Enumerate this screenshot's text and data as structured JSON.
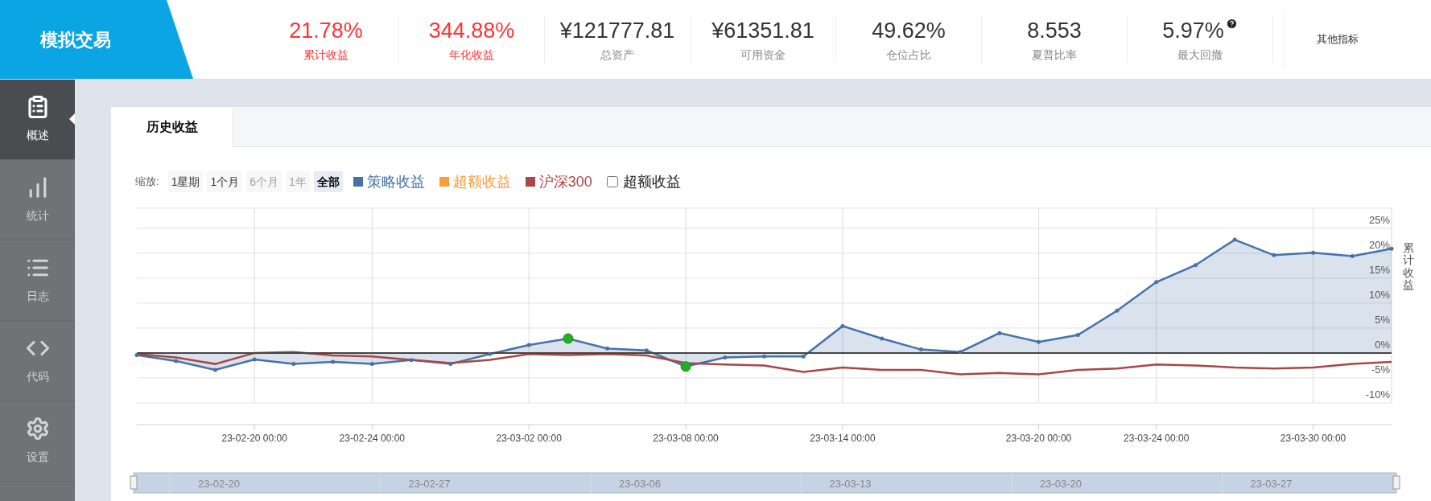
{
  "header": {
    "title": "模拟交易",
    "stats": [
      {
        "value": "21.78%",
        "label": "累计收益",
        "color": "#ff3333",
        "help": false
      },
      {
        "value": "344.88%",
        "label": "年化收益",
        "color": "#ff3333",
        "help": false
      },
      {
        "value": "¥121777.81",
        "label": "总资产",
        "color": "#333333",
        "help": false
      },
      {
        "value": "¥61351.81",
        "label": "可用资金",
        "color": "#333333",
        "help": false
      },
      {
        "value": "49.62%",
        "label": "仓位占比",
        "color": "#333333",
        "help": false
      },
      {
        "value": "8.553",
        "label": "夏普比率",
        "color": "#333333",
        "help": false
      },
      {
        "value": "5.97%",
        "label": "最大回撤",
        "color": "#333333",
        "help": true
      }
    ],
    "more": "其他指标"
  },
  "sidebar": {
    "items": [
      {
        "label": "概述",
        "selected": true
      },
      {
        "label": "统计",
        "selected": false
      },
      {
        "label": "日志",
        "selected": false
      },
      {
        "label": "代码",
        "selected": false
      },
      {
        "label": "设置",
        "selected": false
      }
    ]
  },
  "tabs": [
    {
      "label": "历史收益",
      "selected": true
    }
  ],
  "zoom": {
    "label": "缩放:",
    "buttons": [
      {
        "label": "1星期",
        "selected": false,
        "disabled": false
      },
      {
        "label": "1个月",
        "selected": false,
        "disabled": false
      },
      {
        "label": "6个月",
        "selected": false,
        "disabled": true
      },
      {
        "label": "1年",
        "selected": false,
        "disabled": true
      },
      {
        "label": "全部",
        "selected": true,
        "disabled": false
      }
    ]
  },
  "legend": [
    {
      "kind": "series"
    },
    {
      "label": "超额收益",
      "color": "#f79d3d",
      "kind": "swatch"
    },
    {
      "kind": "series"
    },
    {
      "label": "超额收益",
      "kind": "checkbox",
      "checked": false
    }
  ],
  "chart_data": {
    "type": "line",
    "ylabel": "累计收益",
    "categories": [
      null,
      null,
      null,
      "23-02-20 00:00",
      null,
      null,
      "23-02-24 00:00",
      null,
      null,
      null,
      "23-03-02 00:00",
      null,
      null,
      null,
      "23-03-08 00:00",
      null,
      null,
      null,
      "23-03-14 00:00",
      null,
      null,
      null,
      null,
      "23-03-20 00:00",
      null,
      null,
      "23-03-24 00:00",
      null,
      null,
      null,
      "23-03-30 00:00",
      null,
      null
    ],
    "series": [
      {
        "name": "策略收益",
        "color": "#4572a7",
        "values": [
          -0.4,
          -1.6,
          -3.4,
          -1.3,
          -2.2,
          -1.8,
          -2.2,
          -1.4,
          -2.2,
          -0.2,
          1.6,
          2.9,
          0.9,
          0.5,
          -2.7,
          -0.9,
          -0.7,
          -0.7,
          5.4,
          2.9,
          0.7,
          0.2,
          4.0,
          2.2,
          3.6,
          8.5,
          14.2,
          17.6,
          22.7,
          19.6,
          20.1,
          19.4,
          20.9
        ]
      },
      {
        "name": "沪深300",
        "color": "#aa4643",
        "values": [
          -0.2,
          -0.9,
          -2.2,
          0,
          0.2,
          -0.5,
          -0.7,
          -1.4,
          -2.0,
          -1.4,
          -0.2,
          -0.4,
          -0.2,
          -0.5,
          -2.0,
          -2.3,
          -2.5,
          -3.8,
          -2.9,
          -3.4,
          -3.4,
          -4.3,
          -4.0,
          -4.3,
          -3.4,
          -3.1,
          -2.3,
          -2.5,
          -2.9,
          -3.1,
          -2.9,
          -2.2,
          -1.8
        ]
      }
    ],
    "ylim": [
      -10,
      29
    ],
    "grid": true,
    "yticks": [
      {
        "value": -10,
        "label": "-10%"
      },
      {
        "value": -5,
        "label": "-5%"
      },
      {
        "value": 0,
        "label": "0%"
      },
      {
        "value": 5,
        "label": "5%"
      },
      {
        "value": 10,
        "label": "10%"
      },
      {
        "value": 15,
        "label": "15%"
      },
      {
        "value": 20,
        "label": "20%"
      },
      {
        "value": 25,
        "label": "25%"
      }
    ]
  },
  "flag_markers": {
    "flagged": [
      false,
      false,
      false,
      false,
      false,
      false,
      false,
      false,
      false,
      false,
      false,
      true,
      false,
      false,
      true,
      false,
      false,
      false,
      false,
      false,
      false,
      false,
      false,
      false,
      false,
      false,
      false,
      false,
      false,
      false,
      false,
      false,
      false
    ]
  },
  "navigator": {
    "labels": [
      "23-02-20",
      "23-02-27",
      "23-03-06",
      "23-03-13",
      "23-03-20",
      "23-03-27"
    ]
  }
}
